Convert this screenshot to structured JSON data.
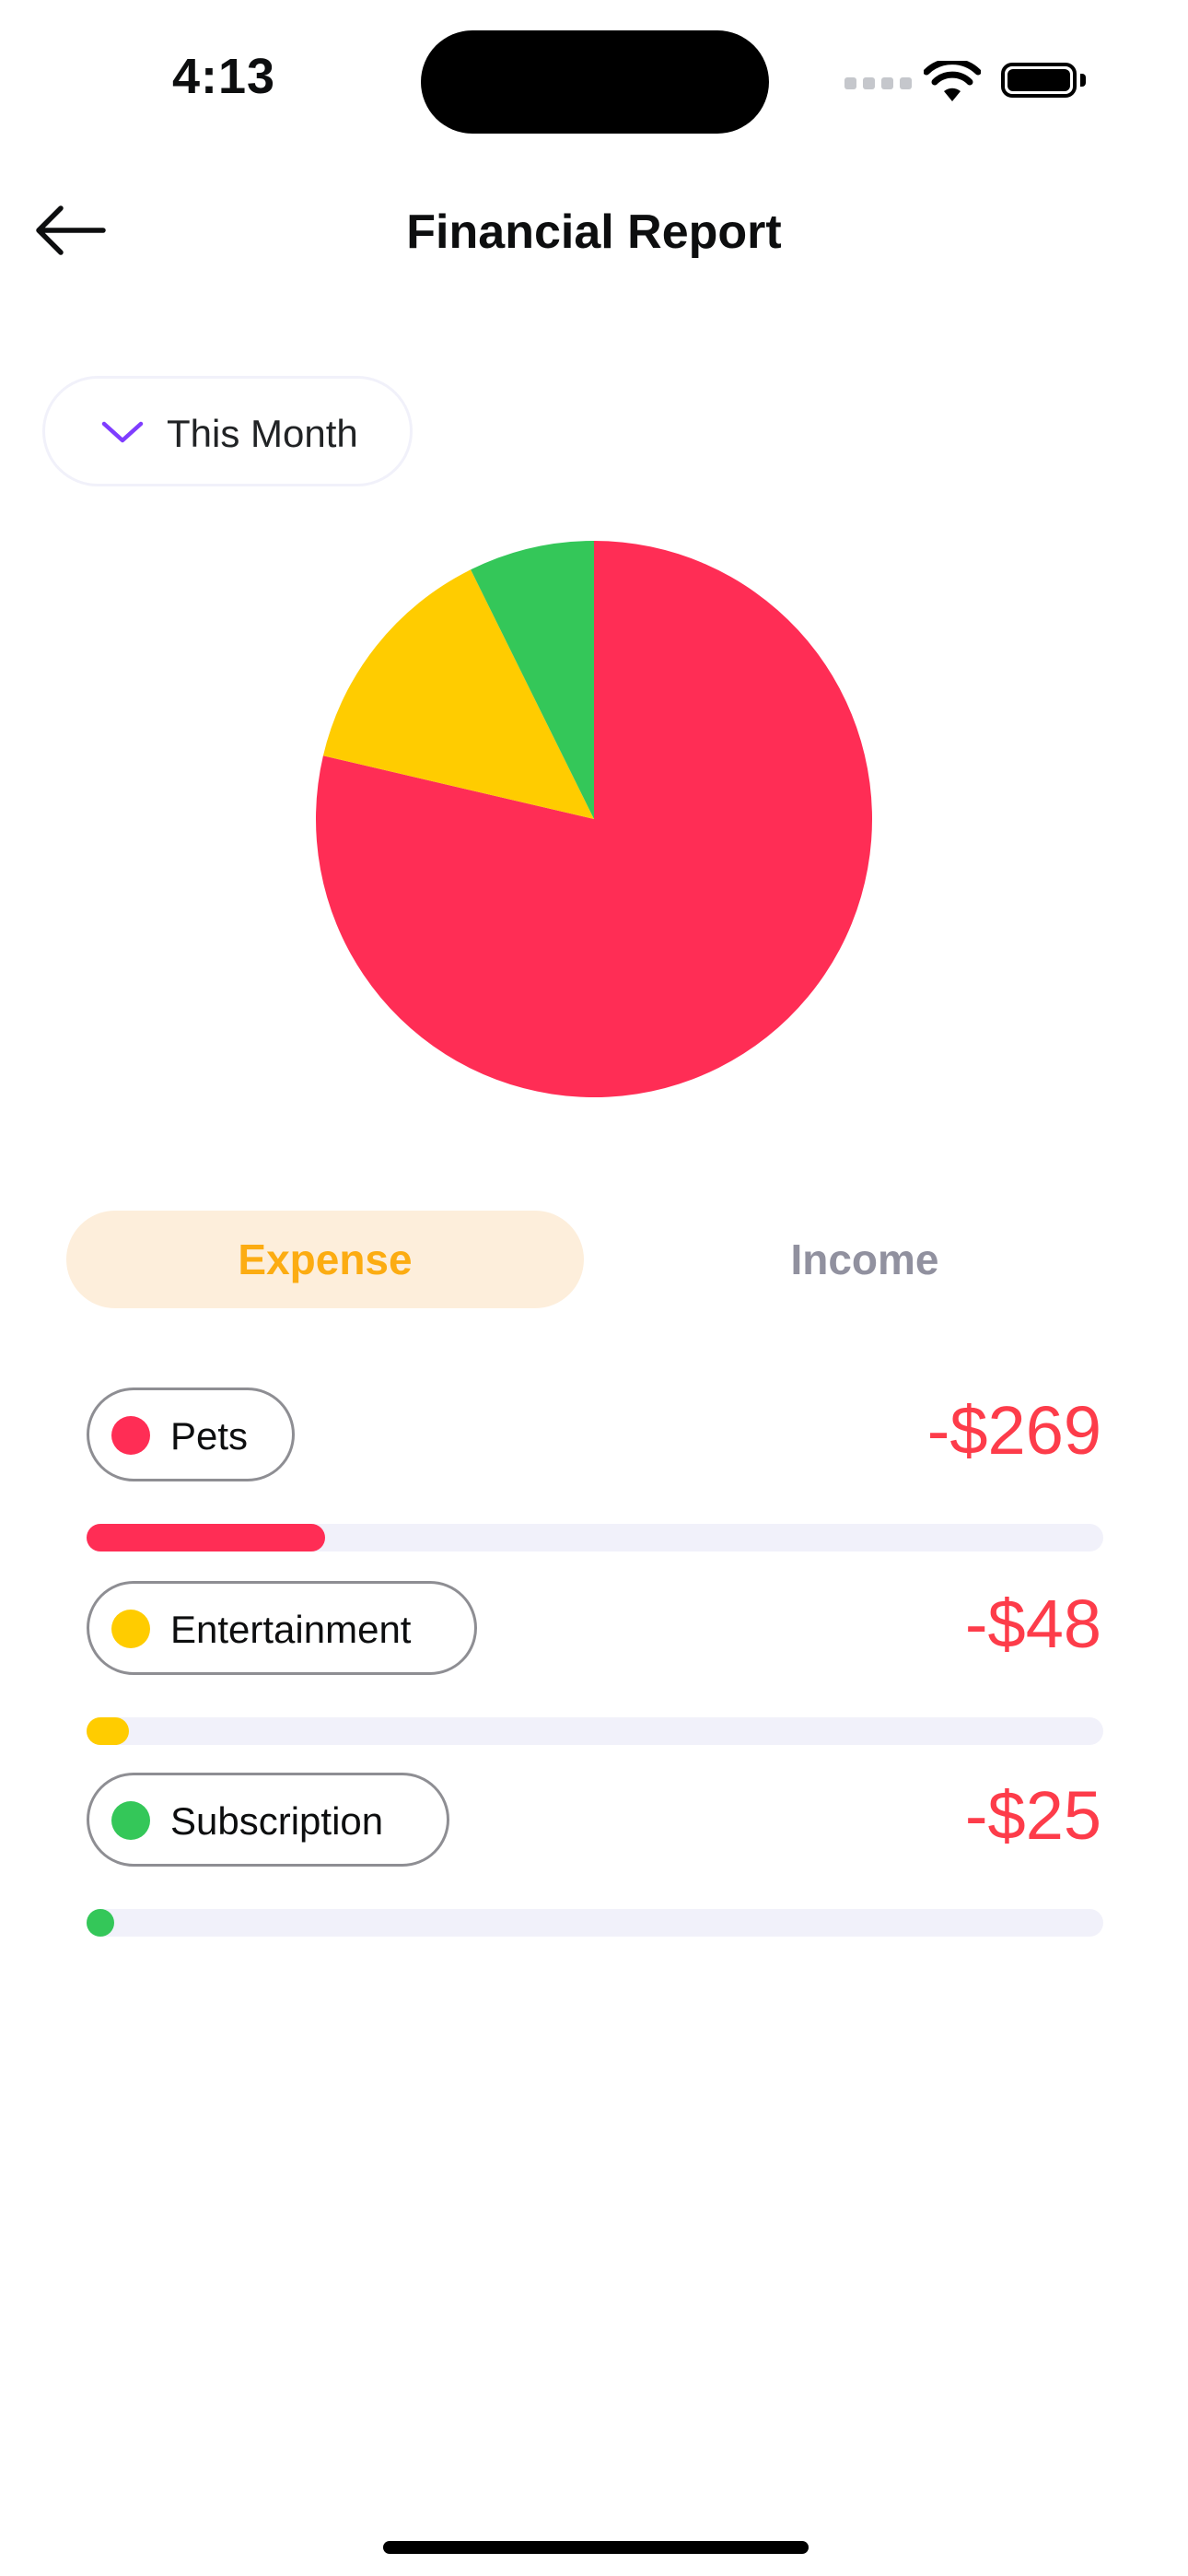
{
  "status_bar": {
    "time": "4:13"
  },
  "header": {
    "title": "Financial Report"
  },
  "period": {
    "label": "This Month"
  },
  "tabs": {
    "expense": "Expense",
    "income": "Income",
    "active": "expense"
  },
  "colors": {
    "pets": "#ff2d55",
    "entertainment": "#ffcc00",
    "subscription": "#34c759",
    "amount": "#fd3c4a",
    "accent": "#fcac12"
  },
  "chart_data": {
    "type": "pie",
    "slices": [
      {
        "name": "Pets",
        "value": 269,
        "color": "#ff2d55"
      },
      {
        "name": "Entertainment",
        "value": 48,
        "color": "#ffcc00"
      },
      {
        "name": "Subscription",
        "value": 25,
        "color": "#34c759"
      }
    ]
  },
  "categories": [
    {
      "name": "Pets",
      "amount": "-$269",
      "color": "#ff2d55",
      "progress": 0.235
    },
    {
      "name": "Entertainment",
      "amount": "-$48",
      "color": "#ffcc00",
      "progress": 0.042
    },
    {
      "name": "Subscription",
      "amount": "-$25",
      "color": "#34c759",
      "progress": 0.022
    }
  ]
}
